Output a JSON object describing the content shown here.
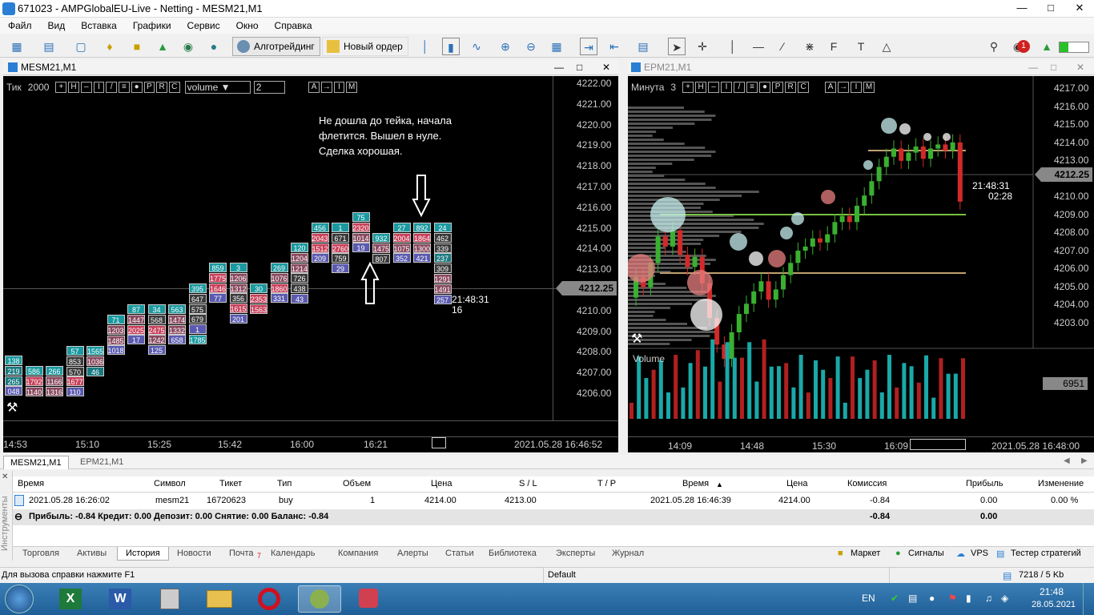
{
  "window": {
    "title": "671023 - AMPGlobalEU-Live - Netting - MESM21,M1"
  },
  "menu": [
    "Файл",
    "Вид",
    "Вставка",
    "Графики",
    "Сервис",
    "Окно",
    "Справка"
  ],
  "toolbar": {
    "algo": "Алготрейдинг",
    "new_order": "Новый ордер",
    "notif_count": "1",
    "lvl": "LVL"
  },
  "left_chart": {
    "title": "MESM21,M1",
    "period_label": "Тик",
    "period_value": "2000",
    "indicator": "volume",
    "indicator_value": "2",
    "btn_icons": [
      "+",
      "H",
      "–",
      "I",
      "/",
      "≡",
      "●",
      "P",
      "R",
      "C"
    ],
    "mode_btns": [
      "A",
      "→",
      "I",
      "M"
    ],
    "annotation": [
      "Не дошла до тейка, начала",
      "флетится. Вышел в нуле.",
      "Сделка хорошая."
    ],
    "prices": [
      "4222.00",
      "4221.00",
      "4220.00",
      "4219.00",
      "4218.00",
      "4217.00",
      "4216.00",
      "4215.00",
      "4214.00",
      "4213.00",
      "4212.25",
      "4211.00",
      "4210.00",
      "4209.00",
      "4208.00",
      "4207.00",
      "4206.00"
    ],
    "current_price": "4212.25",
    "timer": "21:48:31",
    "timer_sub": "16",
    "times": [
      "14:53",
      "15:10",
      "15:25",
      "15:42",
      "16:00",
      "16:21"
    ],
    "datetime": "2021.05.28 16:46:52",
    "cells": [
      [
        [
          "138",
          "219",
          "265",
          "048"
        ]
      ],
      [
        [
          "586",
          "1792",
          "1140"
        ]
      ],
      [
        [
          "266",
          "1166",
          "1316"
        ]
      ],
      [
        [
          "57",
          "853",
          "570",
          "1677",
          "110"
        ]
      ],
      [
        [
          "1565",
          "1036",
          "46"
        ]
      ],
      [
        [
          "71",
          "1203",
          "1485",
          "1018"
        ]
      ],
      [
        [
          "87",
          "1447",
          "2025",
          "17"
        ]
      ],
      [
        [
          "34",
          "568",
          "2475",
          "1242",
          "125"
        ]
      ],
      [
        [
          "563",
          "1474",
          "1332",
          "658"
        ]
      ],
      [
        [
          "395",
          "647",
          "575",
          "679",
          "1"
        ],
        [
          "1785"
        ]
      ],
      [
        [
          "859",
          "1775",
          "1646",
          "77"
        ]
      ],
      [
        [
          "3",
          "1206",
          "1312",
          "356",
          "1615",
          "201"
        ]
      ],
      [
        [
          "30",
          "2353",
          "1563"
        ]
      ],
      [
        [
          "269",
          "1076",
          "1860",
          "331"
        ]
      ],
      [
        [
          "120",
          "1204",
          "1214",
          "726",
          "438",
          "43"
        ]
      ],
      [
        [
          "456",
          "2043",
          "1512",
          "209"
        ]
      ],
      [
        [
          "1",
          "671",
          "2760",
          "759",
          "29"
        ]
      ],
      [
        [
          "75",
          "2320",
          "1014",
          "19"
        ]
      ],
      [
        [
          "932",
          "1475",
          "807"
        ]
      ],
      [
        [
          "27",
          "2004",
          "1075",
          "352"
        ]
      ],
      [
        [
          "892",
          "1864",
          "1300",
          "421"
        ]
      ],
      [
        [
          "24",
          "462",
          "339",
          "237",
          "309",
          "1291",
          "1491",
          "257"
        ]
      ]
    ]
  },
  "right_chart": {
    "title": "EPM21,M1",
    "period_label": "Минута",
    "period_value": "3",
    "prices": [
      "4217.00",
      "4216.00",
      "4215.00",
      "4214.00",
      "4213.00",
      "4212.25",
      "4211.00",
      "4210.00",
      "4209.00",
      "4208.00",
      "4207.00",
      "4206.00",
      "4205.00",
      "4204.00",
      "4203.00"
    ],
    "current_price": "4212.25",
    "timer": "21:48:31",
    "timer_sub": "02:28",
    "volume_label": "Volume",
    "volume_value": "6951",
    "times": [
      "14:09",
      "14:48",
      "15:30",
      "16:09"
    ],
    "datetime": "2021.05.28 16:48:00"
  },
  "chart_tabs": [
    "MESM21,M1",
    "EPM21,M1"
  ],
  "table": {
    "headers": [
      "Время",
      "Символ",
      "Тикет",
      "Тип",
      "Объем",
      "Цена",
      "S / L",
      "T / P",
      "Время",
      "Цена",
      "Комиссия",
      "Прибыль",
      "Изменение"
    ],
    "row": [
      "2021.05.28 16:26:02",
      "mesm21",
      "16720623",
      "buy",
      "1",
      "4214.00",
      "4213.00",
      "",
      "2021.05.28 16:46:39",
      "4214.00",
      "-0.84",
      "0.00",
      "0.00 %"
    ],
    "summary": "Прибыль: -0.84  Кредит: 0.00  Депозит: 0.00  Снятие: 0.00  Баланс: -0.84",
    "summary_commission": "-0.84",
    "summary_profit": "0.00",
    "side_label": "Инструменты"
  },
  "bottom_tabs": [
    "Торговля",
    "Активы",
    "История",
    "Новости",
    "Почта",
    "Календарь",
    "Компания",
    "Алерты",
    "Статьи",
    "Библиотека",
    "Эксперты",
    "Журнал"
  ],
  "mail_count": "7",
  "right_links": [
    "Маркет",
    "Сигналы",
    "VPS",
    "Тестер стратегий"
  ],
  "status": {
    "help": "Для вызова справки нажмите F1",
    "profile": "Default",
    "traffic": "7218 / 5 Kb"
  },
  "taskbar": {
    "lang": "EN",
    "time": "21:48",
    "date": "28.05.2021"
  }
}
